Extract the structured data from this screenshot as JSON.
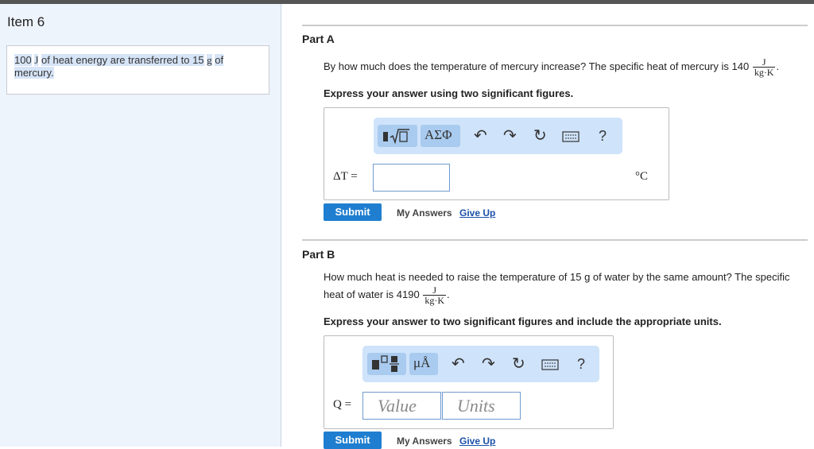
{
  "item": {
    "title": "Item 6"
  },
  "problem": {
    "amount_energy": "100",
    "unit_energy": "J",
    "text_mid": "of heat energy are transferred to 15",
    "unit_mass": "g",
    "text_end_1": "of",
    "text_end_2": "mercury."
  },
  "partA": {
    "title": "Part A",
    "question": "By how much does the temperature of mercury increase? The specific heat of mercury is 140",
    "unit_num": "J",
    "unit_den": "kg·K",
    "question_end": ".",
    "instruction": "Express your answer using two significant figures.",
    "toolbar": {
      "symbols": "ΑΣΦ",
      "help": "?"
    },
    "answer_label": "ΔT =",
    "unit_label": "°C",
    "submit": "Submit",
    "my_answers": "My Answers",
    "give_up": "Give Up"
  },
  "partB": {
    "title": "Part B",
    "question_line1": "How much heat is needed to raise the temperature of 15  g of water by the same amount? The specific",
    "question_line2": "heat of water is 4190",
    "unit_num": "J",
    "unit_den": "kg·K",
    "question_end": ".",
    "instruction": "Express your answer to two significant figures and include the appropriate units.",
    "toolbar": {
      "symbols": "μÅ",
      "help": "?"
    },
    "answer_label": "Q =",
    "value_placeholder": "Value",
    "units_placeholder": "Units",
    "submit": "Submit",
    "my_answers": "My Answers",
    "give_up": "Give Up"
  }
}
